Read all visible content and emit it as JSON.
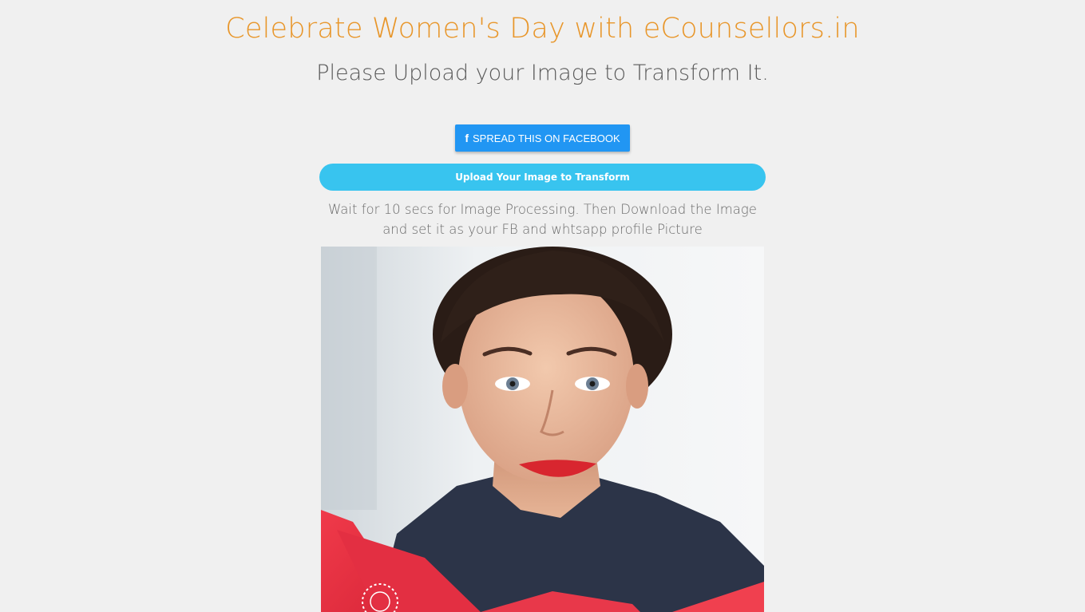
{
  "header": {
    "title": "Celebrate Women's Day with eCounsellors.in",
    "subtitle": "Please Upload your Image to Transform It."
  },
  "actions": {
    "facebook_icon": "f",
    "facebook_label": "SPREAD THIS ON FACEBOOK",
    "upload_label": "Upload Your Image to Transform"
  },
  "instructions": {
    "line1": "Wait for 10 secs for Image Processing. Then Download the Image",
    "line2": "and set it as your FB and whtsapp profile Picture"
  },
  "preview": {
    "description_icon": "portrait-photo"
  },
  "colors": {
    "title": "#e8962a",
    "facebook_button": "#2196f3",
    "upload_button": "#38c4ef",
    "frame_red": "#ee3344"
  }
}
